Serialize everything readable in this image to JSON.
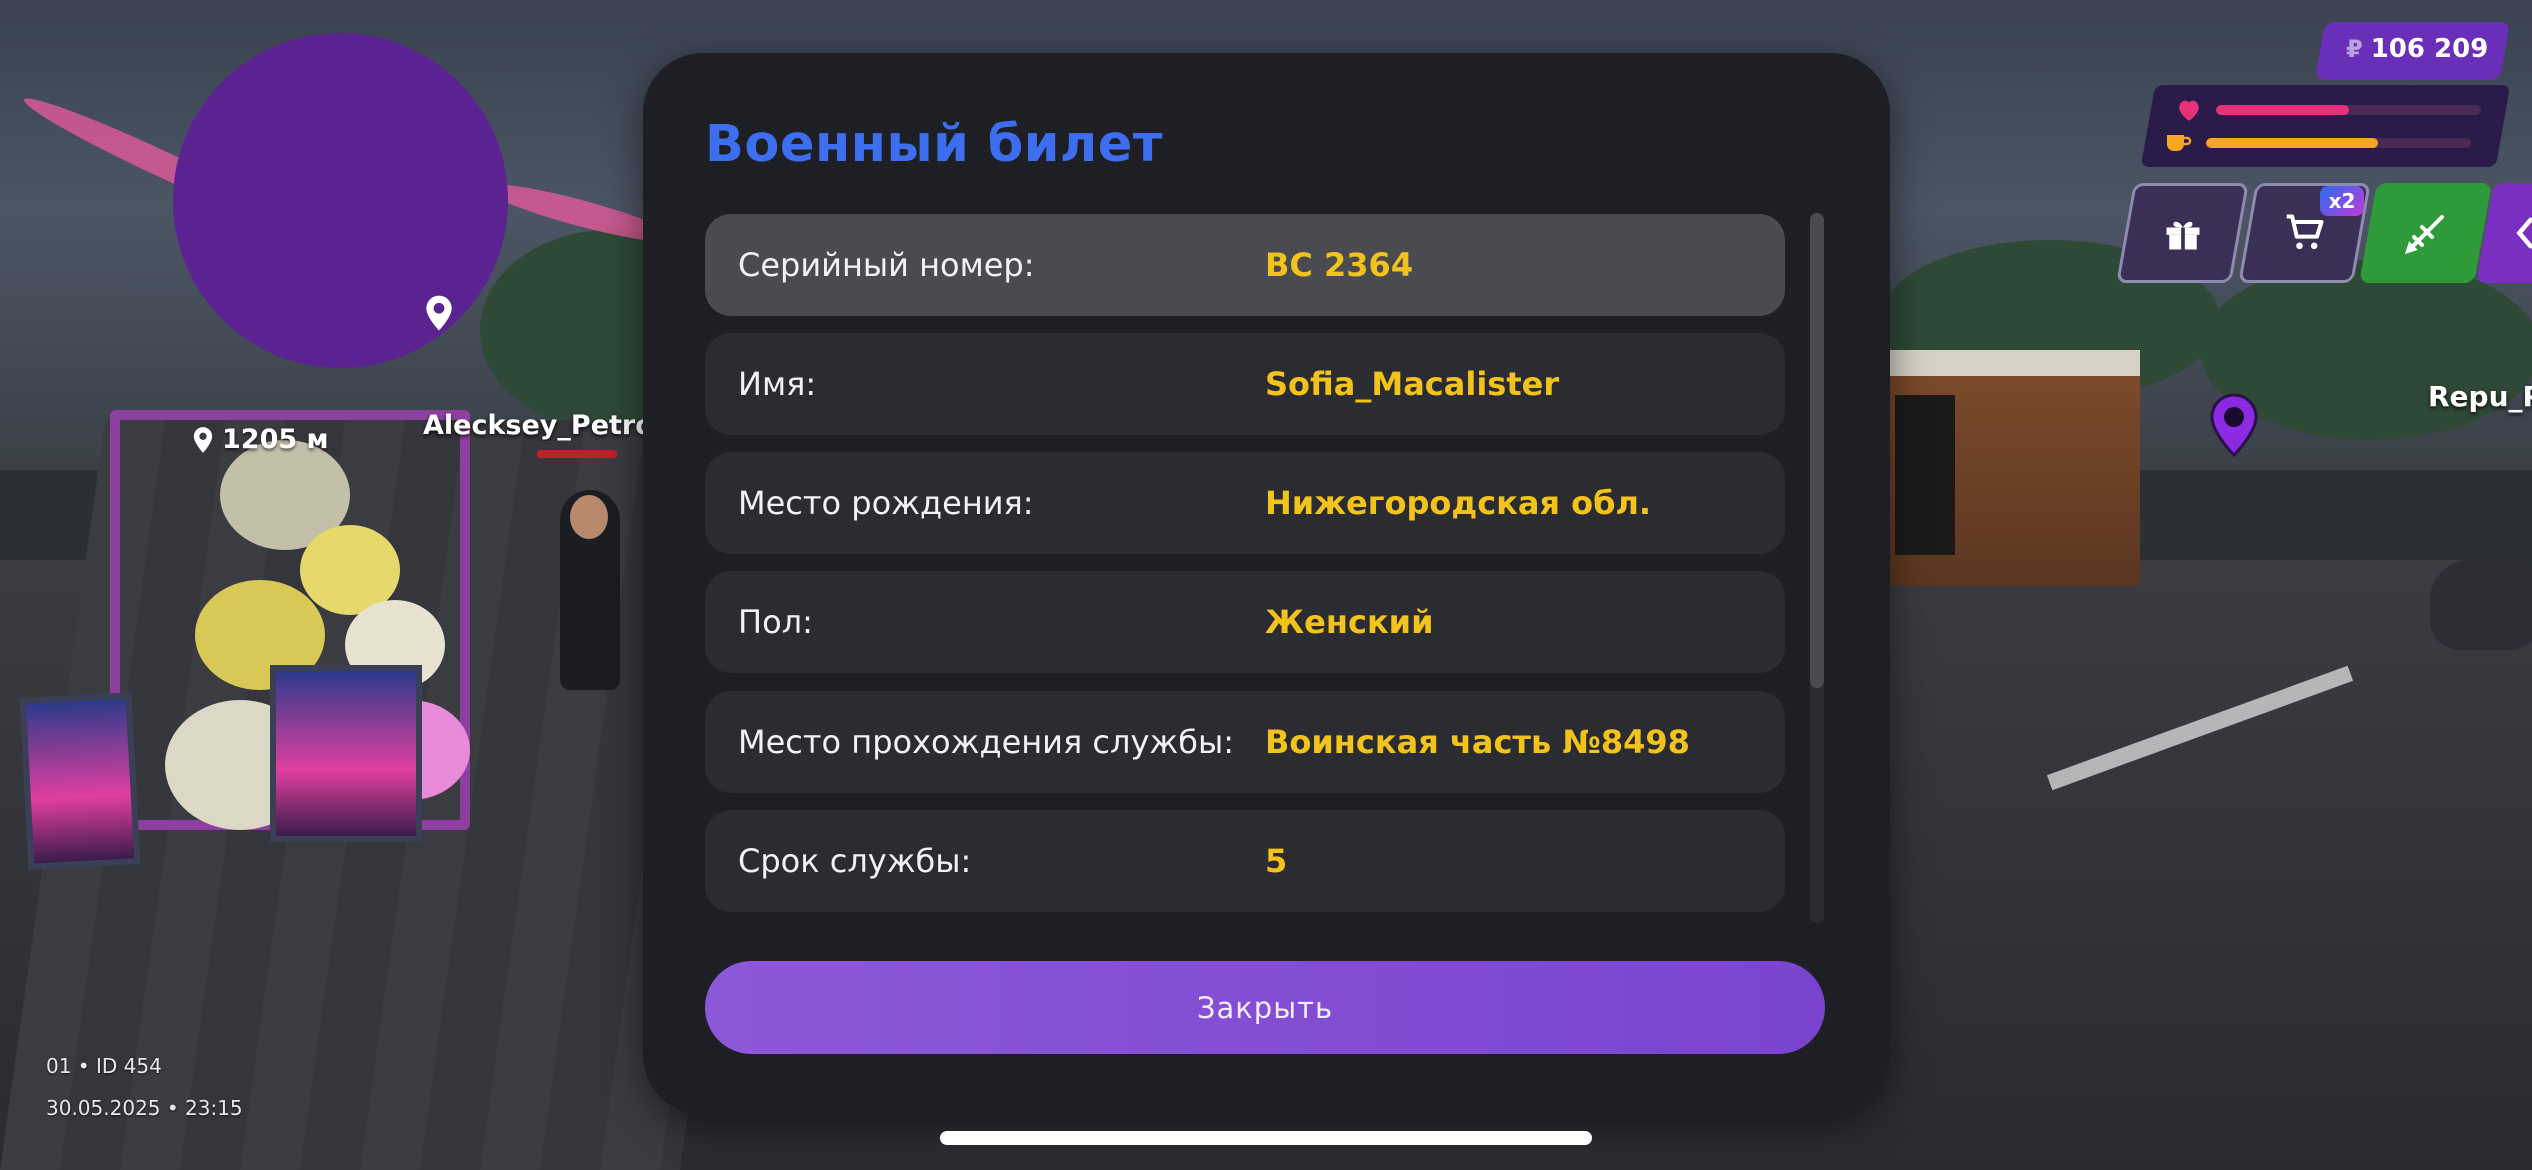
{
  "hud": {
    "map_distance": "1205 м",
    "player_name": "Alecksey_Petrov",
    "other_player_name": "Repu_P",
    "server_line": "01 • ID 454",
    "datetime": "30.05.2025 • 23:15",
    "money_currency": "₽",
    "money": "106 209",
    "health_level": 0.5,
    "hunger_level": 0.65,
    "health_color": "#e8317a",
    "hunger_color": "#f5a623",
    "shop_multiplier": "x2",
    "buttons": [
      "gift-icon",
      "cart-icon",
      "weapon-icon",
      "chevron-left-icon"
    ]
  },
  "modal": {
    "title": "Военный билет",
    "fields": [
      {
        "label": "Серийный номер:",
        "value": "ВС 2364"
      },
      {
        "label": "Имя:",
        "value": "Sofia_Macalister"
      },
      {
        "label": "Место рождения:",
        "value": "Нижегородская обл."
      },
      {
        "label": "Пол:",
        "value": "Женский"
      },
      {
        "label": "Место прохождения службы:",
        "value": "Воинская часть №8498"
      },
      {
        "label": "Срок службы:",
        "value": "5"
      }
    ],
    "close_label": "Закрыть",
    "accent_color": "#3d6ef0",
    "value_color": "#f2c31a"
  }
}
